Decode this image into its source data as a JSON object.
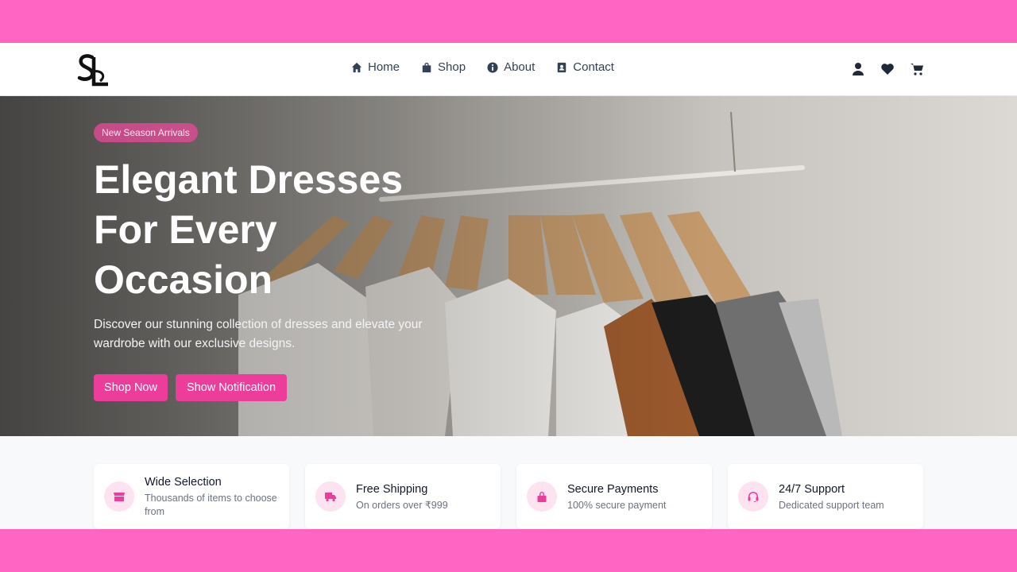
{
  "colors": {
    "accent": "#ec3d9a",
    "frame": "#ff66c4"
  },
  "nav": {
    "links": [
      {
        "label": "Home",
        "icon": "home-icon"
      },
      {
        "label": "Shop",
        "icon": "shopping-bag-icon"
      },
      {
        "label": "About",
        "icon": "info-icon"
      },
      {
        "label": "Contact",
        "icon": "address-book-icon"
      }
    ],
    "icons": [
      "user-icon",
      "heart-icon",
      "cart-icon"
    ]
  },
  "hero": {
    "badge": "New Season Arrivals",
    "title_lines": [
      "Elegant Dresses",
      "For Every",
      "Occasion"
    ],
    "subtitle": "Discover our stunning collection of dresses and elevate your wardrobe with our exclusive designs.",
    "buttons": {
      "shop": "Shop Now",
      "notify": "Show Notification"
    }
  },
  "features": [
    {
      "icon": "store-icon",
      "title": "Wide Selection",
      "desc": "Thousands of items to choose from"
    },
    {
      "icon": "truck-icon",
      "title": "Free Shipping",
      "desc": "On orders over ₹999"
    },
    {
      "icon": "lock-icon",
      "title": "Secure Payments",
      "desc": "100% secure payment"
    },
    {
      "icon": "headset-icon",
      "title": "24/7 Support",
      "desc": "Dedicated support team"
    }
  ]
}
